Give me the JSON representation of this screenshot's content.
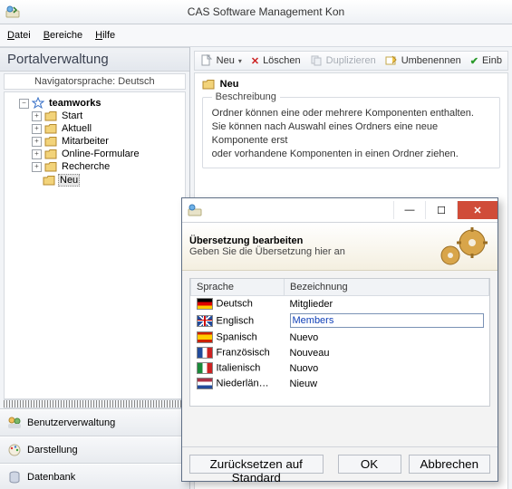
{
  "app": {
    "title": "CAS Software Management Kon"
  },
  "menu": {
    "file": "Datei",
    "areas": "Bereiche",
    "help": "Hilfe"
  },
  "sidebar": {
    "panel_title": "Portalverwaltung",
    "nav_language": "Navigatorsprache: Deutsch",
    "root": "teamworks",
    "items": [
      "Start",
      "Aktuell",
      "Mitarbeiter",
      "Online-Formulare",
      "Recherche",
      "Neu"
    ],
    "accordion": [
      "Benutzerverwaltung",
      "Darstellung",
      "Datenbank"
    ]
  },
  "toolbar": {
    "new": "Neu",
    "delete": "Löschen",
    "duplicate": "Duplizieren",
    "rename": "Umbenennen",
    "embed": "Einb"
  },
  "detail": {
    "title": "Neu",
    "legend": "Beschreibung",
    "line1": "Ordner können eine oder mehrere Komponenten enthalten.",
    "line2": "Sie können nach Auswahl eines Ordners eine neue Komponente erst",
    "line3": "oder vorhandene Komponenten in einen Ordner ziehen."
  },
  "dialog": {
    "title": "Übersetzung bearbeiten",
    "subtitle": "Geben Sie die Übersetzung hier an",
    "col_lang": "Sprache",
    "col_val": "Bezeichnung",
    "rows": [
      {
        "flag": "de",
        "lang": "Deutsch",
        "val": "Mitglieder"
      },
      {
        "flag": "en",
        "lang": "Englisch",
        "val": "Members"
      },
      {
        "flag": "es",
        "lang": "Spanisch",
        "val": "Nuevo"
      },
      {
        "flag": "fr",
        "lang": "Französisch",
        "val": "Nouveau"
      },
      {
        "flag": "it",
        "lang": "Italienisch",
        "val": "Nuovo"
      },
      {
        "flag": "nl",
        "lang": "Niederlän…",
        "val": "Nieuw"
      }
    ],
    "reset": "Zurücksetzen auf Standard",
    "ok": "OK",
    "cancel": "Abbrechen"
  }
}
